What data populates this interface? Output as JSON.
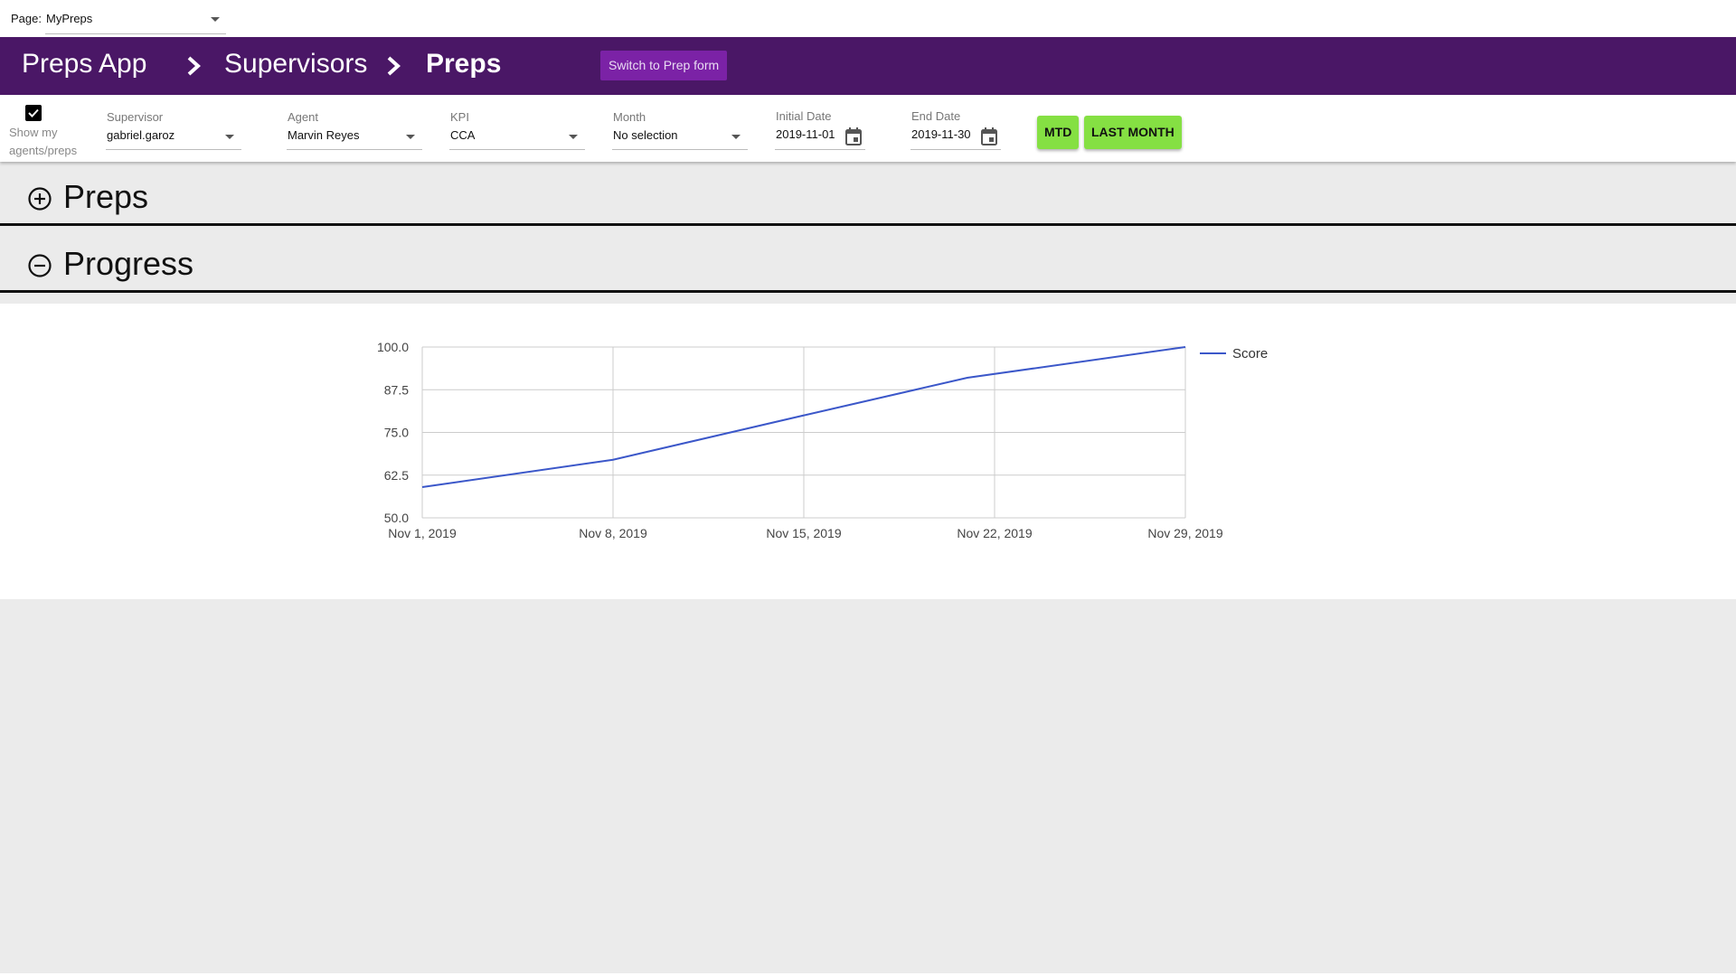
{
  "top": {
    "page_label": "Page:",
    "page_value": "MyPreps"
  },
  "header": {
    "breadcrumbs": [
      "Preps App",
      "Supervisors",
      "Preps"
    ],
    "switch_button": "Switch to Prep form"
  },
  "filters": {
    "show_mine_label": "Show my agents/preps",
    "show_mine_checked": true,
    "supervisor": {
      "label": "Supervisor",
      "value": "gabriel.garoz"
    },
    "agent": {
      "label": "Agent",
      "value": "Marvin Reyes"
    },
    "kpi": {
      "label": "KPI",
      "value": "CCA"
    },
    "month": {
      "label": "Month",
      "value": "No selection"
    },
    "initial_date": {
      "label": "Initial Date",
      "value": "2019-11-01"
    },
    "end_date": {
      "label": "End Date",
      "value": "2019-11-30"
    },
    "mtd_button": "MTD",
    "last_month_button": "LAST MONTH"
  },
  "sections": {
    "preps": {
      "title": "Preps",
      "expanded": false
    },
    "progress": {
      "title": "Progress",
      "expanded": true
    }
  },
  "colors": {
    "header": "#4a1766",
    "switch_button": "#7b22a6",
    "green_button": "#85e043",
    "series": "#3b57c9"
  },
  "chart_data": {
    "type": "line",
    "x": [
      "2019-11-01",
      "2019-11-08",
      "2019-11-15",
      "2019-11-21",
      "2019-11-29"
    ],
    "x_tick_labels": [
      "Nov 1, 2019",
      "Nov 8, 2019",
      "Nov 15, 2019",
      "Nov 22, 2019",
      "Nov 29, 2019"
    ],
    "y_tick_labels": [
      "100.0",
      "87.5",
      "75.0",
      "62.5",
      "50.0"
    ],
    "ylim": [
      50,
      100
    ],
    "series": [
      {
        "name": "Score",
        "values": [
          59,
          67,
          80,
          91,
          100
        ]
      }
    ],
    "grid": true,
    "legend": "right"
  }
}
